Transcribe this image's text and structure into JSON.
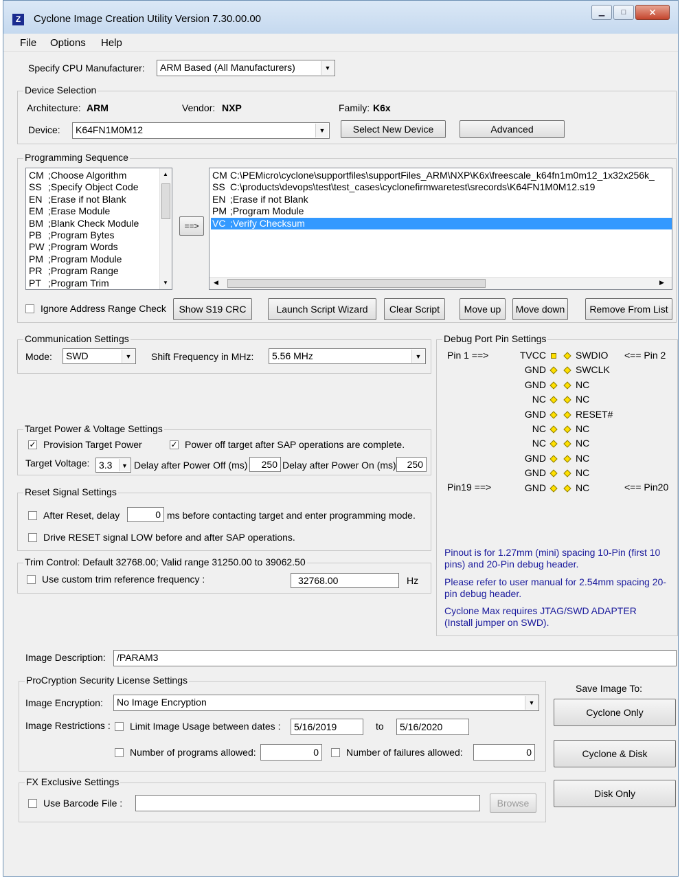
{
  "window": {
    "title": "Cyclone Image Creation Utility Version 7.30.00.00"
  },
  "menu": [
    "File",
    "Options",
    "Help"
  ],
  "cpu": {
    "label": "Specify CPU Manufacturer:",
    "value": "ARM Based (All Manufacturers)"
  },
  "device_selection": {
    "title": "Device Selection",
    "architecture_label": "Architecture:",
    "architecture": "ARM",
    "vendor_label": "Vendor:",
    "vendor": "NXP",
    "family_label": "Family:",
    "family": "K6x",
    "device_label": "Device:",
    "device": "K64FN1M0M12",
    "select_new": "Select New Device",
    "advanced": "Advanced"
  },
  "programming": {
    "title": "Programming Sequence",
    "available": [
      {
        "code": "CM",
        "desc": ";Choose Algorithm"
      },
      {
        "code": "SS",
        "desc": ";Specify Object Code"
      },
      {
        "code": "EN",
        "desc": ";Erase if not Blank"
      },
      {
        "code": "EM",
        "desc": ";Erase Module"
      },
      {
        "code": "BM",
        "desc": ";Blank Check Module"
      },
      {
        "code": "PB",
        "desc": ";Program Bytes"
      },
      {
        "code": "PW",
        "desc": ";Program Words"
      },
      {
        "code": "PM",
        "desc": ";Program Module"
      },
      {
        "code": "PR",
        "desc": ";Program Range"
      },
      {
        "code": "PT",
        "desc": ";Program Trim"
      }
    ],
    "add_button": "==>",
    "script": [
      {
        "code": "CM",
        "desc": "C:\\PEMicro\\cyclone\\supportfiles\\supportFiles_ARM\\NXP\\K6x\\freescale_k64fn1m0m12_1x32x256k_"
      },
      {
        "code": "SS",
        "desc": "C:\\products\\devops\\test\\test_cases\\cyclonefirmwaretest\\srecords\\K64FN1M0M12.s19"
      },
      {
        "code": "EN",
        "desc": ";Erase if not Blank"
      },
      {
        "code": "PM",
        "desc": ";Program Module"
      },
      {
        "code": "VC",
        "desc": ";Verify Checksum"
      }
    ],
    "ignore_label": "Ignore Address Range Check",
    "buttons": {
      "show_crc": "Show S19 CRC",
      "wizard": "Launch Script  Wizard",
      "clear": "Clear Script",
      "up": "Move up",
      "down": "Move down",
      "remove": "Remove From List"
    }
  },
  "comm": {
    "title": "Communication Settings",
    "mode_label": "Mode:",
    "mode": "SWD",
    "freq_label": "Shift Frequency in MHz:",
    "freq": "5.56 MHz"
  },
  "power": {
    "title": "Target Power & Voltage Settings",
    "provision": "Provision Target Power",
    "poweroff": "Power off target after SAP operations are complete.",
    "voltage_label": "Target Voltage:",
    "voltage": "3.3",
    "delay_off_label": "Delay after Power Off (ms)",
    "delay_off": "250",
    "delay_on_label": "Delay after Power On (ms)",
    "delay_on": "250"
  },
  "reset": {
    "title": "Reset Signal Settings",
    "after_label": "After Reset, delay",
    "after_value": "0",
    "after_suffix": "ms before contacting target and enter programming mode.",
    "drive_label": "Drive RESET signal LOW before and after SAP operations."
  },
  "trim": {
    "title": "Trim Control: Default 32768.00; Valid range 31250.00 to 39062.50",
    "custom_label": "Use custom trim reference frequency :",
    "value": "32768.00",
    "unit": "Hz"
  },
  "debug": {
    "title": "Debug Port Pin Settings",
    "pin1": "Pin 1 ==>",
    "pin2": "<== Pin 2",
    "pin19": "Pin19 ==>",
    "pin20": "<== Pin20",
    "rows": [
      {
        "left": "TVCC",
        "right": "SWDIO"
      },
      {
        "left": "GND",
        "right": "SWCLK"
      },
      {
        "left": "GND",
        "right": "NC"
      },
      {
        "left": "NC",
        "right": "NC"
      },
      {
        "left": "GND",
        "right": "RESET#"
      },
      {
        "left": "NC",
        "right": "NC"
      },
      {
        "left": "NC",
        "right": "NC"
      },
      {
        "left": "GND",
        "right": "NC"
      },
      {
        "left": "GND",
        "right": "NC"
      },
      {
        "left": "GND",
        "right": "NC"
      }
    ],
    "note1": "Pinout is for 1.27mm (mini) spacing 10-Pin (first 10 pins) and 20-Pin debug header.",
    "note2": "Please refer to user manual for 2.54mm spacing 20-pin debug header.",
    "note3": "Cyclone Max requires JTAG/SWD ADAPTER (Install jumper on SWD)."
  },
  "image": {
    "desc_label": "Image Description:",
    "desc": "/PARAM3"
  },
  "procryption": {
    "title": "ProCryption Security License Settings",
    "enc_label": "Image Encryption:",
    "enc": "No Image Encryption",
    "restrict_label": "Image Restrictions :",
    "limit_label": "Limit Image Usage between dates :",
    "date_from": "5/16/2019",
    "to": "to",
    "date_to": "5/16/2020",
    "programs_label": "Number of programs allowed:",
    "programs": "0",
    "failures_label": "Number of failures allowed:",
    "failures": "0"
  },
  "fx": {
    "title": "FX Exclusive Settings",
    "barcode_label": "Use Barcode File :",
    "browse": "Browse"
  },
  "save": {
    "label": "Save Image To:",
    "cyclone_only": "Cyclone Only",
    "cyclone_disk": "Cyclone & Disk",
    "disk_only": "Disk Only"
  },
  "colors": {
    "selection": "#3399ff",
    "note_blue": "#1a1a9c",
    "pin_dot": "#ffe000"
  }
}
